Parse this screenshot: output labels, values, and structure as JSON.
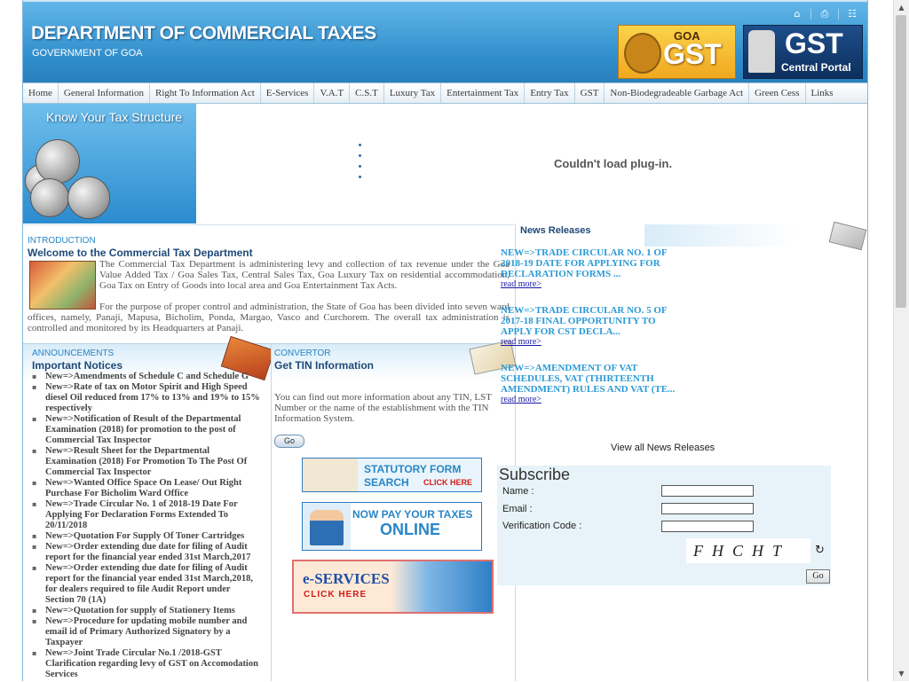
{
  "header": {
    "title": "DEPARTMENT OF COMMERCIAL TAXES",
    "subtitle": "GOVERNMENT OF GOA",
    "icons": [
      "home-icon",
      "print-icon",
      "sitemap-icon"
    ],
    "goa_gst": {
      "small": "GOA",
      "big": "GST"
    },
    "central_gst": {
      "big": "GST",
      "small": "Central Portal"
    }
  },
  "nav": [
    "Home",
    "General Information",
    "Right To Information Act",
    "E-Services",
    "V.A.T",
    "C.S.T",
    "Luxury Tax",
    "Entertainment Tax",
    "Entry Tax",
    "GST",
    "Non-Biodegradeable Garbage Act",
    "Green Cess",
    "Links"
  ],
  "banner": {
    "title": "Know Your Tax Structure",
    "plugin_message": "Couldn't load plug-in."
  },
  "intro": {
    "label": "INTRODUCTION",
    "title": "Welcome to the Commercial Tax Department",
    "p1": "The Commercial Tax Department is administering levy and collection of tax revenue under the Goa Value Added Tax / Goa Sales Tax, Central Sales Tax, Goa Luxury Tax on residential accommodation, Goa Tax on Entry of Goods into local area and Goa Entertainment Tax Acts.",
    "p2": "For the purpose of proper control and administration, the State of Goa has been divided into seven ward offices, namely, Panaji, Mapusa, Bicholim, Ponda, Margao, Vasco and Curchorem. The overall tax administration is controlled and monitored by its Headquarters at Panaji."
  },
  "announcements": {
    "label": "ANNOUNCEMENTS",
    "title": "Important Notices",
    "items": [
      "New=>Amendments of Schedule C and Schedule G",
      "New=>Rate of tax on Motor Spirit and High Speed diesel Oil reduced from 17% to 13% and 19% to 15% respectively",
      "New=>Notification of Result of the Departmental Examination (2018) for promotion to the post of Commercial Tax Inspector",
      "New=>Result Sheet for the Departmental Examination (2018) For Promotion To The Post Of Commercial Tax Inspector",
      "New=>Wanted Office Space On Lease/ Out Right Purchase For Bicholim Ward Office",
      "New=>Trade Circular No. 1 of 2018-19 Date For Applying For Declaration Forms Extended To 20/11/2018",
      "New=>Quotation For Supply Of Toner Cartridges",
      "New=>Order extending due date for filing of Audit report for the financial year ended 31st March,2017",
      "New=>Order extending due date for filing of Audit report for the financial year ended 31st March,2018, for dealers required to file Audit Report under Section 70 (1A)",
      "New=>Quotation for supply of Stationery Items",
      "New=>Procedure for updating mobile number and email id of Primary Authorized Signatory by a Taxpayer",
      "New=>Joint Trade Circular No.1 /2018-GST Clarification regarding levy of GST on Accomodation Services"
    ]
  },
  "convertor": {
    "label": "CONVERTOR",
    "title": "Get TIN Information",
    "text": "You can find out more information about any TIN, LST Number or the name of the establishment with the TIN Information System.",
    "go": "Go",
    "statutory": {
      "l1": "STATUTORY FORM",
      "l2": "SEARCH",
      "l3": "CLICK HERE"
    },
    "pay": {
      "l1": "NOW PAY YOUR TAXES",
      "l2": "ONLINE"
    },
    "eservices": {
      "l1": "e-SERVICES",
      "l2": "CLICK HERE"
    }
  },
  "news": {
    "title": "News Releases",
    "items": [
      {
        "headline": "NEW=>TRADE CIRCULAR NO. 1 OF 2018-19 DATE FOR APPLYING FOR DECLARATION FORMS ...",
        "more": "read more>"
      },
      {
        "headline": "NEW=>TRADE CIRCULAR NO. 5 OF 2017-18 FINAL OPPORTUNITY TO APPLY FOR CST DECLA...",
        "more": "read more>"
      },
      {
        "headline": "NEW=>AMENDMENT OF VAT SCHEDULES, VAT (THIRTEENTH AMENDMENT) RULES AND VAT (TE...",
        "more": "read more>"
      }
    ],
    "view_all": "View all News Releases"
  },
  "subscribe": {
    "title": "Subscribe",
    "name_label": "Name :",
    "email_label": "Email :",
    "code_label": "Verification Code :",
    "captcha": "FHCHT",
    "go": "Go"
  }
}
